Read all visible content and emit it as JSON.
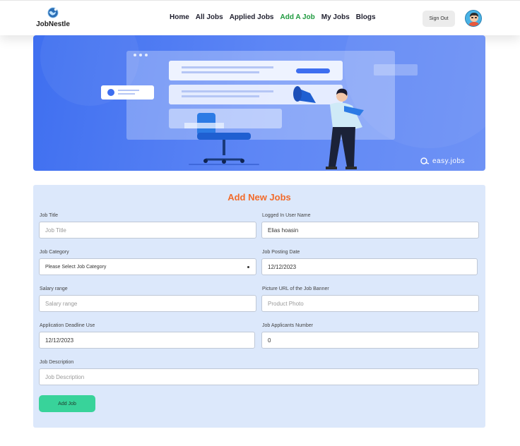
{
  "brand": {
    "name": "JobNestle",
    "logo_icon": "globe-logo-icon"
  },
  "nav": {
    "links": [
      {
        "label": "Home",
        "active": false
      },
      {
        "label": "All Jobs",
        "active": false
      },
      {
        "label": "Applied Jobs",
        "active": false
      },
      {
        "label": "Add A Job",
        "active": true
      },
      {
        "label": "My Jobs",
        "active": false
      },
      {
        "label": "Blogs",
        "active": false
      }
    ],
    "signout_label": "Sign Out",
    "avatar_icon": "user-avatar-icon",
    "active_color": "#1f9a3f"
  },
  "banner": {
    "watermark": "easy.jobs"
  },
  "form": {
    "title": "Add New Jobs",
    "title_color": "#f26b2b",
    "fields": {
      "job_title": {
        "label": "Job Title",
        "value": "",
        "placeholder": "Job Title"
      },
      "user_name": {
        "label": "Logged In User Name",
        "value": "Elias hoasin",
        "placeholder": ""
      },
      "category": {
        "label": "Job Category",
        "value": "Please Select Job Category",
        "placeholder": ""
      },
      "posting_date": {
        "label": "Job Posting Date",
        "value": "12/12/2023",
        "placeholder": ""
      },
      "salary": {
        "label": "Salary range",
        "value": "",
        "placeholder": "Salary range"
      },
      "banner_url": {
        "label": "Picture URL of the Job Banner",
        "value": "",
        "placeholder": "Product Photo"
      },
      "deadline": {
        "label": "Application Deadline Use",
        "value": "12/12/2023",
        "placeholder": ""
      },
      "applicants": {
        "label": "Job Applicants Number",
        "value": "0",
        "placeholder": ""
      },
      "description": {
        "label": "Job Description",
        "value": "",
        "placeholder": "Job Description"
      }
    },
    "submit_label": "Add Job",
    "submit_color": "#38d39a"
  }
}
